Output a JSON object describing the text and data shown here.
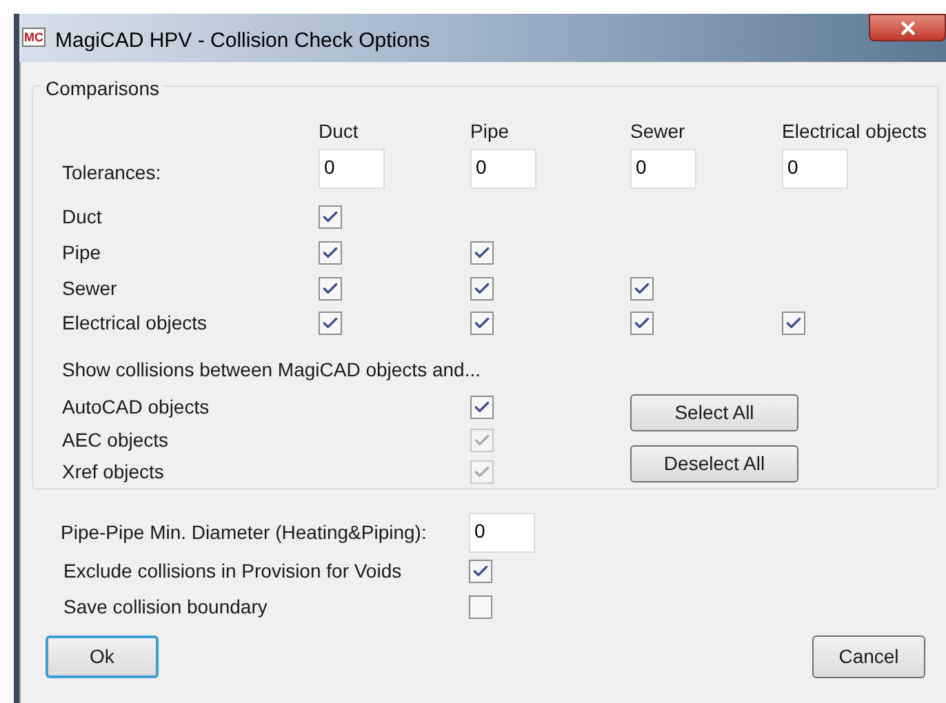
{
  "window": {
    "logo": "MC",
    "title": "MagiCAD HPV - Collision Check Options"
  },
  "comparisons": {
    "title": "Comparisons",
    "columns": [
      "Duct",
      "Pipe",
      "Sewer",
      "Electrical objects"
    ],
    "tolerances": {
      "label": "Tolerances:",
      "values": [
        "0",
        "0",
        "0",
        "0"
      ]
    },
    "rows": [
      {
        "label": "Duct",
        "checks": [
          {
            "checked": true
          }
        ]
      },
      {
        "label": "Pipe",
        "checks": [
          {
            "checked": true
          },
          {
            "checked": true
          }
        ]
      },
      {
        "label": "Sewer",
        "checks": [
          {
            "checked": true
          },
          {
            "checked": true
          },
          {
            "checked": true
          }
        ]
      },
      {
        "label": "Electrical objects",
        "checks": [
          {
            "checked": true
          },
          {
            "checked": true
          },
          {
            "checked": true
          },
          {
            "checked": true
          }
        ]
      }
    ],
    "note": "Show collisions between MagiCAD objects and...",
    "objects": [
      {
        "label": "AutoCAD objects",
        "checked": true,
        "disabled": false
      },
      {
        "label": "AEC objects",
        "checked": true,
        "disabled": true
      },
      {
        "label": "Xref objects",
        "checked": true,
        "disabled": true
      }
    ],
    "buttons": [
      "Select All",
      "Deselect All"
    ]
  },
  "diameter": {
    "label": "Pipe-Pipe Min. Diameter (Heating&Piping):",
    "value": "0"
  },
  "options": [
    {
      "label": "Exclude collisions in Provision for Voids",
      "checked": true
    },
    {
      "label": "Save collision boundary",
      "checked": false
    }
  ],
  "buttons": [
    {
      "label": "Ok",
      "default": true
    },
    {
      "label": "Cancel",
      "default": false
    }
  ]
}
